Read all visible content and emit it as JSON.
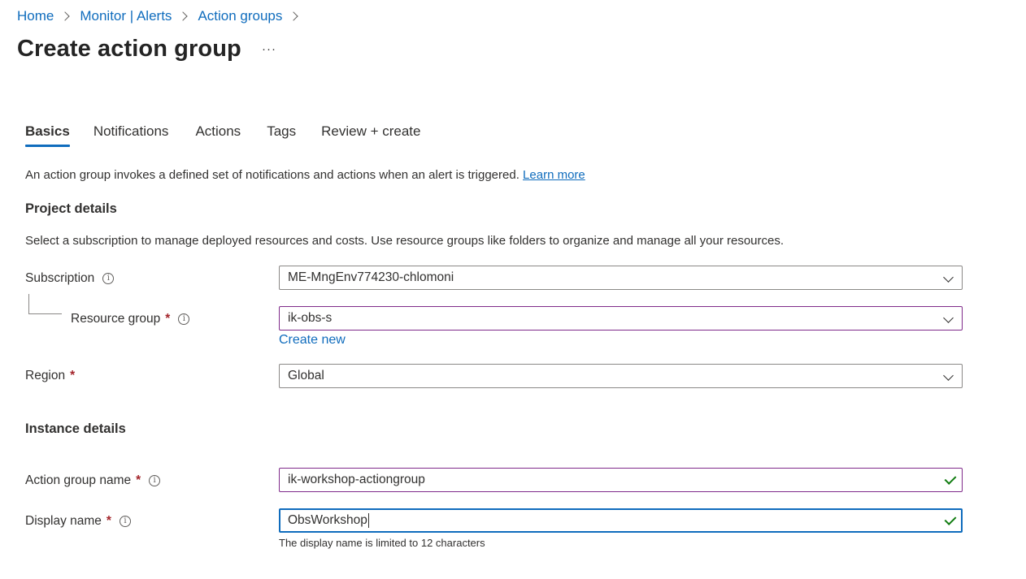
{
  "breadcrumb": [
    "Home",
    "Monitor | Alerts",
    "Action groups"
  ],
  "page_title": "Create action group",
  "more_label": "···",
  "tabs": [
    "Basics",
    "Notifications",
    "Actions",
    "Tags",
    "Review + create"
  ],
  "active_tab": "Basics",
  "intro": {
    "text": "An action group invokes a defined set of notifications and actions when an alert is triggered.",
    "link": "Learn more"
  },
  "project_details": {
    "heading": "Project details",
    "description": "Select a subscription to manage deployed resources and costs. Use resource groups like folders to organize and manage all your resources.",
    "subscription_label": "Subscription",
    "subscription_value": "ME-MngEnv774230-chlomoni",
    "resource_group_label": "Resource group",
    "resource_group_value": "ik-obs-s",
    "create_new": "Create new",
    "region_label": "Region",
    "region_value": "Global"
  },
  "instance_details": {
    "heading": "Instance details",
    "action_group_name_label": "Action group name",
    "action_group_name_value": "ik-workshop-actiongroup",
    "display_name_label": "Display name",
    "display_name_value": "ObsWorkshop",
    "display_name_hint": "The display name is limited to 12 characters"
  },
  "required_mark": "*",
  "info_glyph": "i",
  "colors": {
    "accent": "#0f6cbd",
    "required": "#a4262c",
    "valid": "#107c10",
    "field_highlight": "#7f2a8a"
  }
}
